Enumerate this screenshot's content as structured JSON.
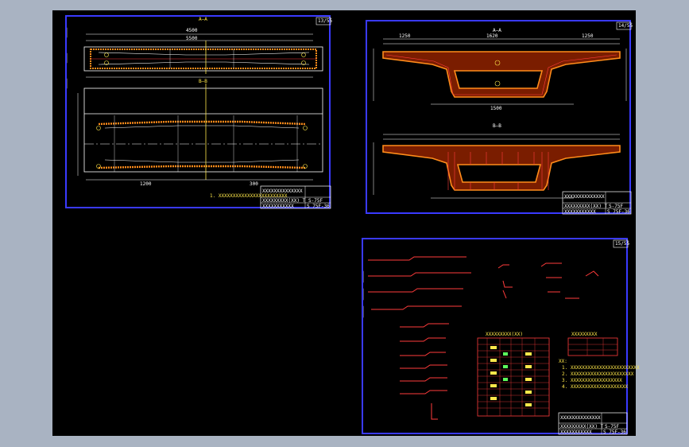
{
  "sheets": [
    {
      "id": "s1",
      "sheet_number": "13/55",
      "title_block": {
        "project": "XXXXXXXXXXXXXX",
        "drawing_title": "XXXXXXXXX(XX) T",
        "designer": "XXXXXXXXXXX",
        "drawing_code": "S-75F",
        "drawing_no": "S 75F-36"
      },
      "section_marks": [
        "A—A",
        "B—B"
      ],
      "notes": [
        "1. XXXXXXXXXXXXXXXXXXXXXXXX"
      ],
      "dims": [
        "5500",
        "4500",
        "1200",
        "300"
      ]
    },
    {
      "id": "s2",
      "sheet_number": "14/55",
      "title_block": {
        "project": "XXXXXXXXXXXXXX",
        "drawing_title": "XXXXXXXXX(XX) T",
        "designer": "XXXXXXXXXXX",
        "drawing_code": "S-75F",
        "drawing_no": "S 75F-36"
      },
      "section_marks": [
        "A—A",
        "B—B"
      ],
      "dims": [
        "1250",
        "1620",
        "1500",
        "1250"
      ]
    },
    {
      "id": "s3",
      "sheet_number": "15/55",
      "title_block": {
        "project": "XXXXXXXXXXXXXX",
        "drawing_title": "XXXXXXXXX(XX) T",
        "designer": "XXXXXXXXXXX",
        "drawing_code": "S-75F",
        "drawing_no": "S 75F-36"
      },
      "table_title": "XXXXXXXXX(XX)",
      "table2_title": "XXXXXXXXX",
      "notes": [
        "XX:",
        "1. XXXXXXXXXXXXXXXXXXXXXXXX",
        "2. XXXXXXXXXXXXXXXXXXXXXX",
        "3. XXXXXXXXXXXXXXXXXX",
        "4. XXXXXXXXXXXXXXXXXXXX"
      ]
    }
  ],
  "colors": {
    "background": "#000000",
    "viewport": "#a9b3c2",
    "frame": "#3a3aff",
    "line": "#ffffff",
    "rebar": "#ff3b3b",
    "fill": "#ff8c1a",
    "text": "#ffe84a"
  }
}
